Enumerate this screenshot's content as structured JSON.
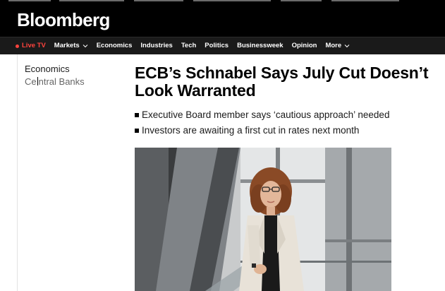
{
  "site": {
    "logo": "Bloomberg"
  },
  "nav": {
    "live": "Live TV",
    "items": [
      "Markets",
      "Economics",
      "Industries",
      "Tech",
      "Politics",
      "Businessweek",
      "Opinion",
      "More"
    ]
  },
  "section": {
    "primary": "Economics",
    "secondary_before_cursor": "Ce",
    "secondary_after_cursor": "ntral Banks"
  },
  "article": {
    "headline_line1": "ECB’s Schnabel Says July Cut Doesn’t",
    "headline_line2": "Look Warranted",
    "bullets": [
      "Executive Board member says ‘cautious approach’ needed",
      "Investors are awaiting a first cut in rates next month"
    ]
  },
  "colors": {
    "accent": "#ff433d",
    "masthead": "#000000",
    "navbar": "#1a1a1a"
  }
}
